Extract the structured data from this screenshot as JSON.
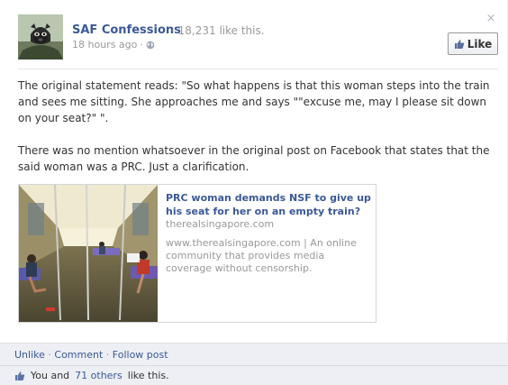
{
  "post": {
    "page_name": "SAF Confessions",
    "likes_count": "18,231 like this.",
    "timestamp": "18 hours ago",
    "like_button_label": "Like",
    "close_glyph": "×",
    "message_paragraph_1": "The original statement reads: \"So what happens is that this woman steps into the train and sees me sitting. She approaches me and says \"\"excuse me, may I please sit down on your seat?\" \".",
    "message_paragraph_2": "There was no mention whatsoever in the original post on Facebook that states that the said woman was a PRC. Just a clarification."
  },
  "link_preview": {
    "title": "PRC woman demands NSF to give up his seat for her on an empty train?",
    "domain": "therealsingapore.com",
    "description": "www.therealsingapore.com | An online community that provides media coverage without censorship."
  },
  "footer": {
    "unlike": "Unlike",
    "comment": "Comment",
    "follow": "Follow post",
    "separator": "·",
    "summary_prefix": "You and",
    "summary_link": "71 others",
    "summary_suffix": "like this."
  },
  "icons": {
    "close": "close-icon",
    "globe": "globe-icon",
    "thumb": "thumbs-up-icon"
  },
  "colors": {
    "link_blue": "#3b5998",
    "muted_gray": "#999999",
    "footer_bg": "#edeff4"
  }
}
